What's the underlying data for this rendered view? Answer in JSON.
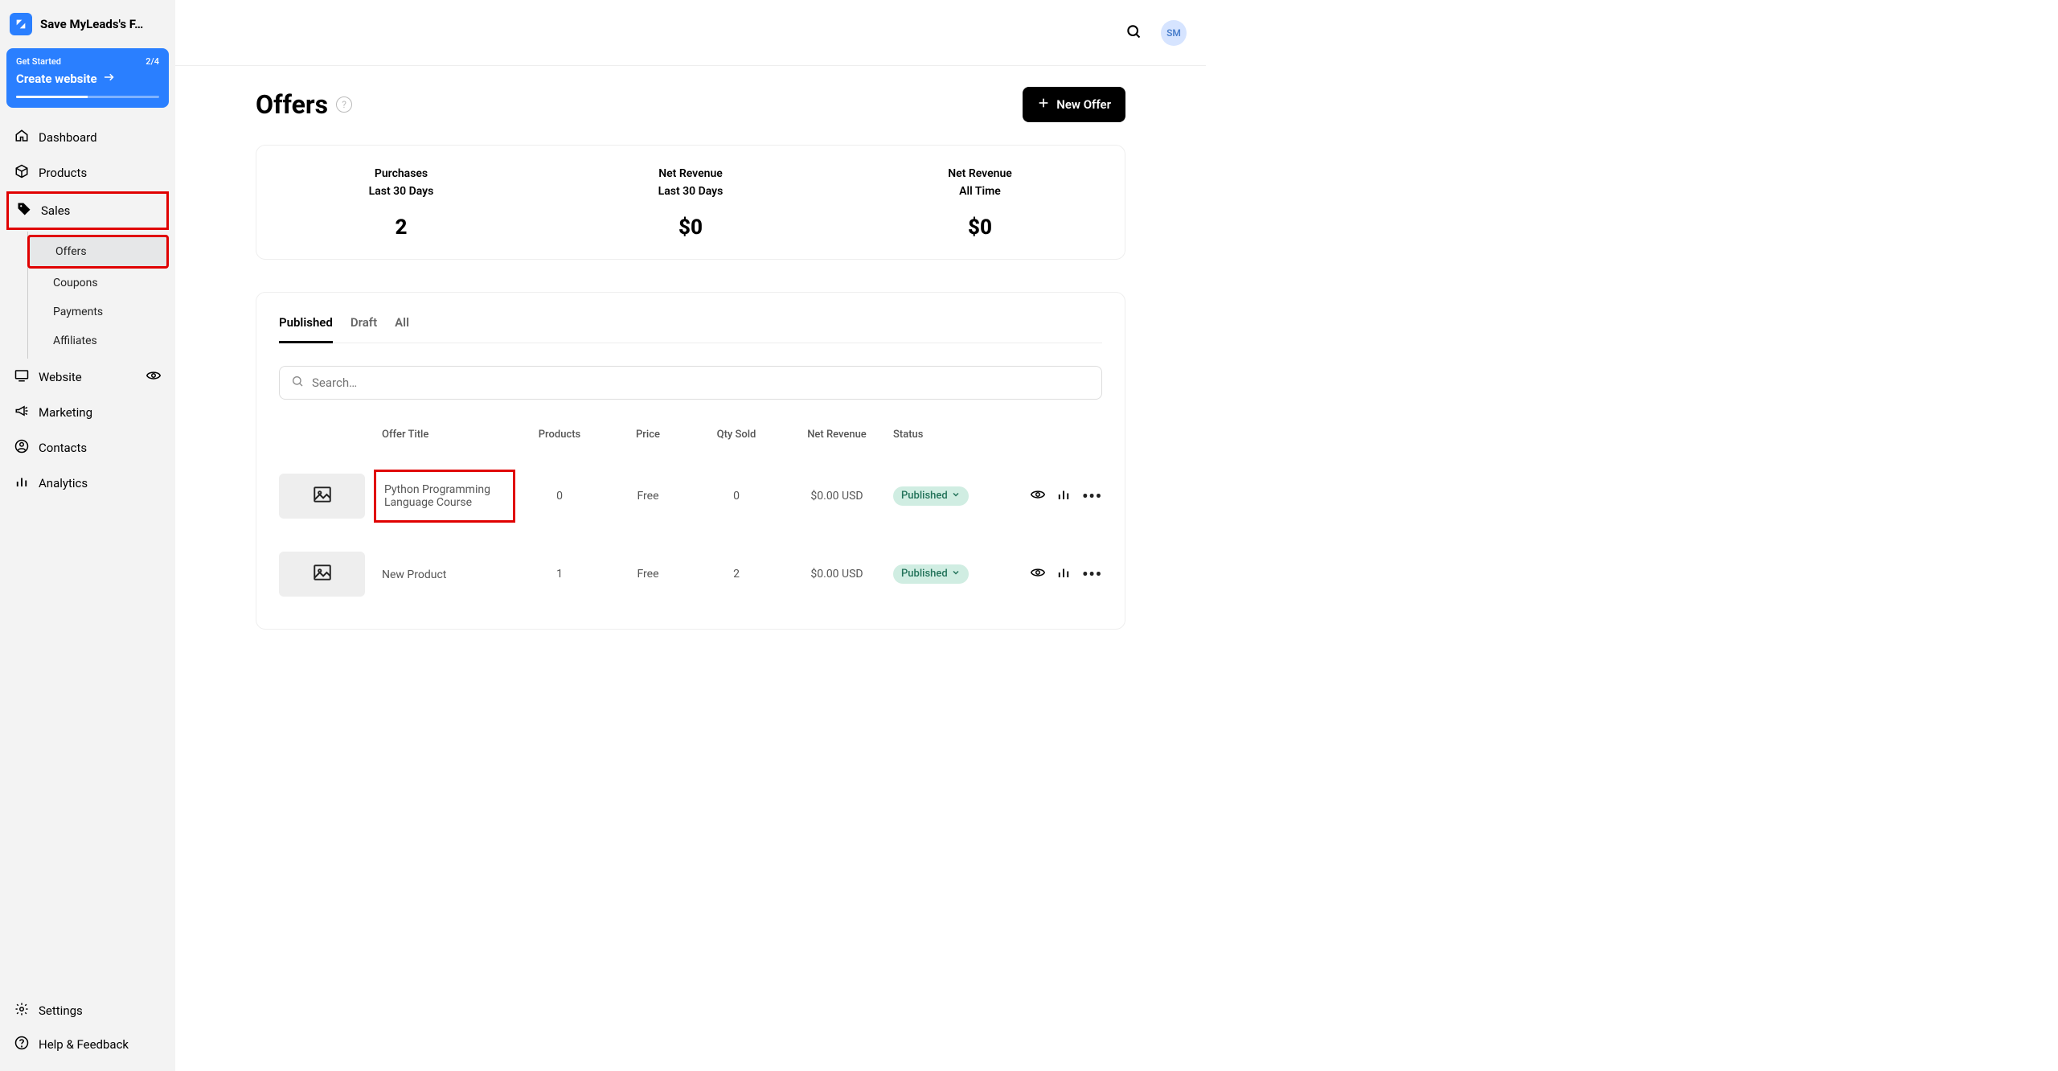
{
  "workspace_name": "Save MyLeads's F…",
  "get_started": {
    "label": "Get Started",
    "progress_text": "2/4",
    "title": "Create website"
  },
  "sidebar": {
    "dashboard": "Dashboard",
    "products": "Products",
    "sales": "Sales",
    "offers": "Offers",
    "coupons": "Coupons",
    "payments": "Payments",
    "affiliates": "Affiliates",
    "website": "Website",
    "marketing": "Marketing",
    "contacts": "Contacts",
    "analytics": "Analytics",
    "settings": "Settings",
    "help": "Help & Feedback"
  },
  "avatar_initials": "SM",
  "page": {
    "title": "Offers",
    "new_offer_button": "New Offer"
  },
  "stats": [
    {
      "label1": "Purchases",
      "label2": "Last 30 Days",
      "value": "2"
    },
    {
      "label1": "Net Revenue",
      "label2": "Last 30 Days",
      "value": "$0"
    },
    {
      "label1": "Net Revenue",
      "label2": "All Time",
      "value": "$0"
    }
  ],
  "tabs": {
    "published": "Published",
    "draft": "Draft",
    "all": "All"
  },
  "search_placeholder": "Search…",
  "table": {
    "headers": {
      "title": "Offer Title",
      "products": "Products",
      "price": "Price",
      "qty": "Qty Sold",
      "net_revenue": "Net Revenue",
      "status": "Status"
    },
    "rows": [
      {
        "title": "Python Programming Language Course",
        "products": "0",
        "price": "Free",
        "qty": "0",
        "net_revenue": "$0.00 USD",
        "status": "Published"
      },
      {
        "title": "New Product",
        "products": "1",
        "price": "Free",
        "qty": "2",
        "net_revenue": "$0.00 USD",
        "status": "Published"
      }
    ]
  }
}
